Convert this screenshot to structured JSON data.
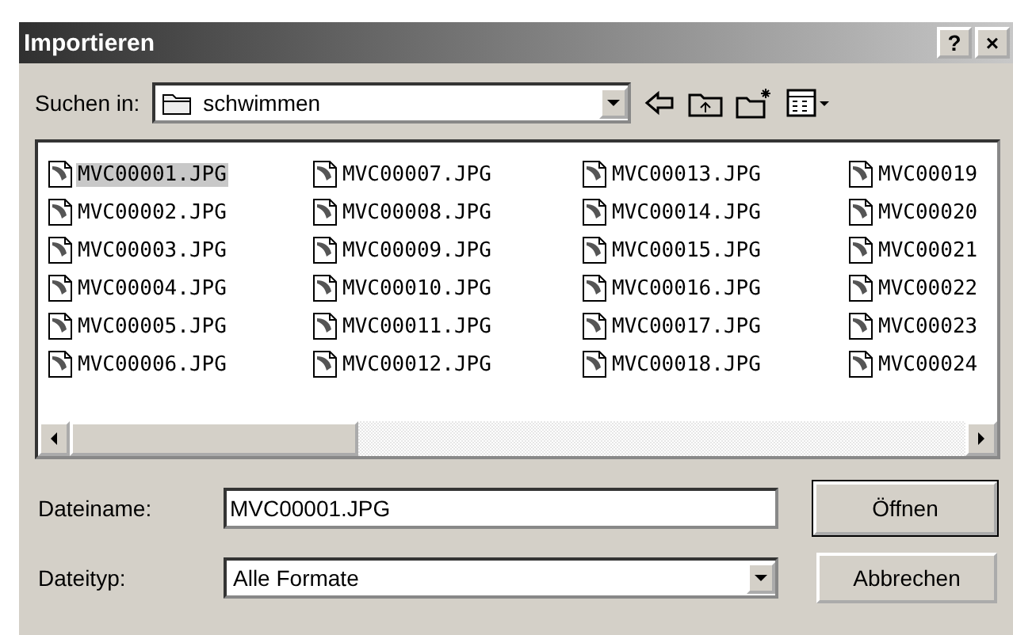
{
  "window": {
    "title": "Importieren",
    "buttons": [
      "?",
      "×"
    ]
  },
  "look_in": {
    "label": "Suchen in:",
    "value": "schwimmen"
  },
  "files": [
    {
      "name": "MVC00001.JPG",
      "selected": true
    },
    {
      "name": "MVC00002.JPG",
      "selected": false
    },
    {
      "name": "MVC00003.JPG",
      "selected": false
    },
    {
      "name": "MVC00004.JPG",
      "selected": false
    },
    {
      "name": "MVC00005.JPG",
      "selected": false
    },
    {
      "name": "MVC00006.JPG",
      "selected": false
    },
    {
      "name": "MVC00007.JPG",
      "selected": false
    },
    {
      "name": "MVC00008.JPG",
      "selected": false
    },
    {
      "name": "MVC00009.JPG",
      "selected": false
    },
    {
      "name": "MVC00010.JPG",
      "selected": false
    },
    {
      "name": "MVC00011.JPG",
      "selected": false
    },
    {
      "name": "MVC00012.JPG",
      "selected": false
    },
    {
      "name": "MVC00013.JPG",
      "selected": false
    },
    {
      "name": "MVC00014.JPG",
      "selected": false
    },
    {
      "name": "MVC00015.JPG",
      "selected": false
    },
    {
      "name": "MVC00016.JPG",
      "selected": false
    },
    {
      "name": "MVC00017.JPG",
      "selected": false
    },
    {
      "name": "MVC00018.JPG",
      "selected": false
    },
    {
      "name": "MVC00019",
      "selected": false
    },
    {
      "name": "MVC00020",
      "selected": false
    },
    {
      "name": "MVC00021",
      "selected": false
    },
    {
      "name": "MVC00022",
      "selected": false
    },
    {
      "name": "MVC00023",
      "selected": false
    },
    {
      "name": "MVC00024",
      "selected": false
    }
  ],
  "file_name": {
    "label": "Dateiname:",
    "value": "MVC00001.JPG"
  },
  "file_type": {
    "label": "Dateityp:",
    "value": "Alle Formate"
  },
  "buttons": [
    {
      "label": "Öffnen",
      "default": true
    },
    {
      "label": "Abbrechen",
      "default": false
    }
  ]
}
